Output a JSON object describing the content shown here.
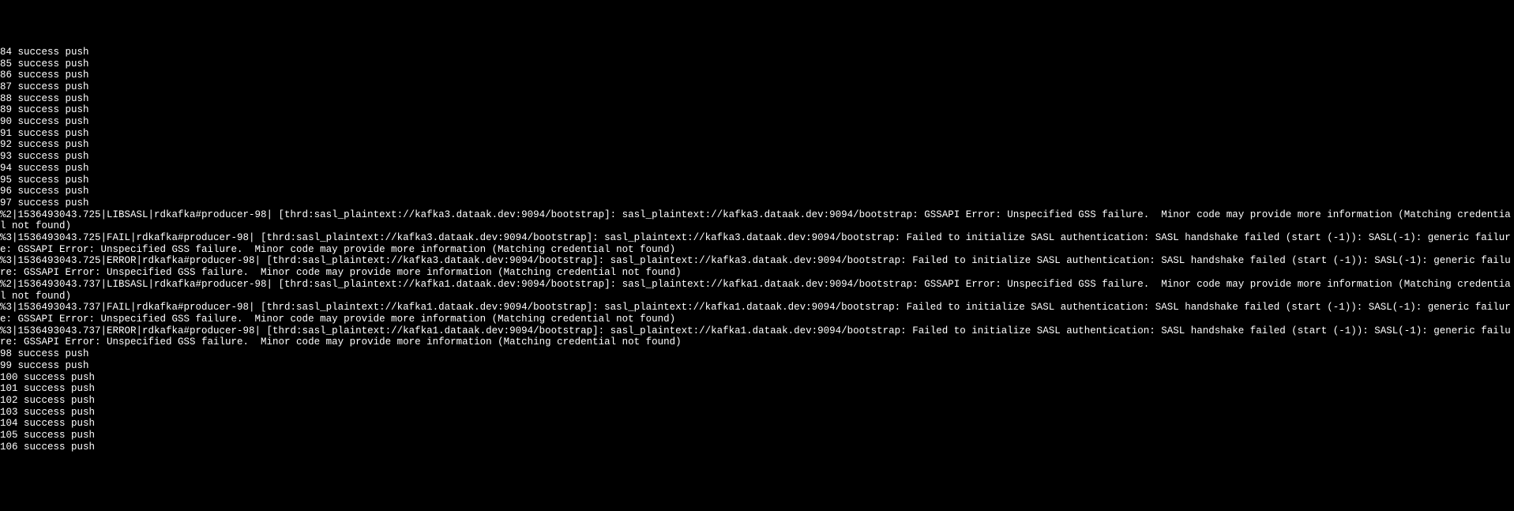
{
  "terminal": {
    "lines": [
      "84 success push",
      "85 success push",
      "86 success push",
      "87 success push",
      "88 success push",
      "89 success push",
      "90 success push",
      "91 success push",
      "92 success push",
      "93 success push",
      "94 success push",
      "95 success push",
      "96 success push",
      "97 success push",
      "%2|1536493043.725|LIBSASL|rdkafka#producer-98| [thrd:sasl_plaintext://kafka3.dataak.dev:9094/bootstrap]: sasl_plaintext://kafka3.dataak.dev:9094/bootstrap: GSSAPI Error: Unspecified GSS failure.  Minor code may provide more information (Matching credential not found)",
      "%3|1536493043.725|FAIL|rdkafka#producer-98| [thrd:sasl_plaintext://kafka3.dataak.dev:9094/bootstrap]: sasl_plaintext://kafka3.dataak.dev:9094/bootstrap: Failed to initialize SASL authentication: SASL handshake failed (start (-1)): SASL(-1): generic failure: GSSAPI Error: Unspecified GSS failure.  Minor code may provide more information (Matching credential not found)",
      "%3|1536493043.725|ERROR|rdkafka#producer-98| [thrd:sasl_plaintext://kafka3.dataak.dev:9094/bootstrap]: sasl_plaintext://kafka3.dataak.dev:9094/bootstrap: Failed to initialize SASL authentication: SASL handshake failed (start (-1)): SASL(-1): generic failure: GSSAPI Error: Unspecified GSS failure.  Minor code may provide more information (Matching credential not found)",
      "%2|1536493043.737|LIBSASL|rdkafka#producer-98| [thrd:sasl_plaintext://kafka1.dataak.dev:9094/bootstrap]: sasl_plaintext://kafka1.dataak.dev:9094/bootstrap: GSSAPI Error: Unspecified GSS failure.  Minor code may provide more information (Matching credential not found)",
      "%3|1536493043.737|FAIL|rdkafka#producer-98| [thrd:sasl_plaintext://kafka1.dataak.dev:9094/bootstrap]: sasl_plaintext://kafka1.dataak.dev:9094/bootstrap: Failed to initialize SASL authentication: SASL handshake failed (start (-1)): SASL(-1): generic failure: GSSAPI Error: Unspecified GSS failure.  Minor code may provide more information (Matching credential not found)",
      "%3|1536493043.737|ERROR|rdkafka#producer-98| [thrd:sasl_plaintext://kafka1.dataak.dev:9094/bootstrap]: sasl_plaintext://kafka1.dataak.dev:9094/bootstrap: Failed to initialize SASL authentication: SASL handshake failed (start (-1)): SASL(-1): generic failure: GSSAPI Error: Unspecified GSS failure.  Minor code may provide more information (Matching credential not found)",
      "98 success push",
      "99 success push",
      "100 success push",
      "101 success push",
      "102 success push",
      "103 success push",
      "104 success push",
      "105 success push",
      "106 success push"
    ]
  }
}
